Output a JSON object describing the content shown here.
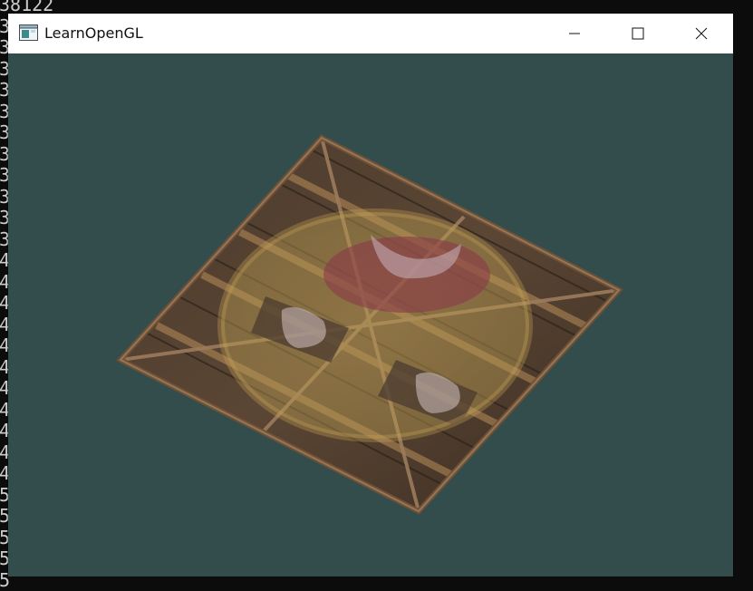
{
  "console": {
    "lines": "38122\n3\n3\n3\n3\n3\n3\n3\n3\n3\n3\n3\n4\n4\n4\n4\n4\n4\n4\n4\n4\n4\n4\n5\n5\n5\n5\n5"
  },
  "window": {
    "title": "LearnOpenGL",
    "icon": "app-window-icon",
    "controls": {
      "minimize": "minimize-icon",
      "maximize": "maximize-icon",
      "close": "close-icon"
    }
  },
  "viewport": {
    "clear_color": "#334d4d",
    "content": "textured-quad"
  }
}
